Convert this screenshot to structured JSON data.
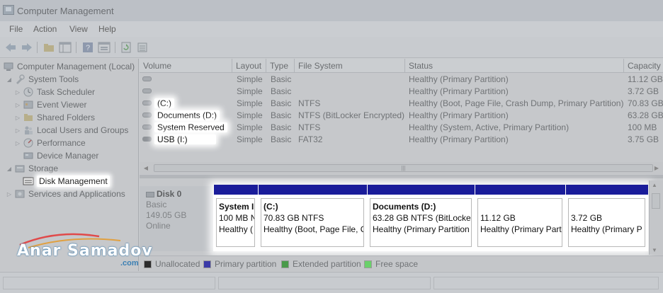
{
  "window": {
    "title": "Computer Management"
  },
  "menu": [
    {
      "label": "File"
    },
    {
      "label": "Action"
    },
    {
      "label": "View"
    },
    {
      "label": "Help"
    }
  ],
  "toolbar": {
    "back_icon": "back-arrow-icon",
    "forward_icon": "forward-arrow-icon",
    "up_icon": "up-folder-icon",
    "show_hide_icon": "show-hide-tree-icon",
    "help_icon": "help-icon",
    "properties_icon": "properties-icon",
    "refresh_icon": "refresh-icon",
    "export_icon": "export-list-icon"
  },
  "tree": {
    "root": "Computer Management (Local)",
    "items": [
      {
        "label": "System Tools",
        "icon": "tools-icon"
      },
      {
        "label": "Task Scheduler",
        "icon": "clock-icon"
      },
      {
        "label": "Event Viewer",
        "icon": "event-viewer-icon"
      },
      {
        "label": "Shared Folders",
        "icon": "shared-folder-icon"
      },
      {
        "label": "Local Users and Groups",
        "icon": "users-icon"
      },
      {
        "label": "Performance",
        "icon": "performance-icon"
      },
      {
        "label": "Device Manager",
        "icon": "device-manager-icon"
      },
      {
        "label": "Storage",
        "icon": "storage-icon"
      },
      {
        "label": "Disk Management",
        "icon": "disk-management-icon"
      },
      {
        "label": "Services and Applications",
        "icon": "services-icon"
      }
    ]
  },
  "volumes": {
    "columns": [
      "Volume",
      "Layout",
      "Type",
      "File System",
      "Status",
      "Capacity"
    ],
    "rows": [
      {
        "volume": "",
        "layout": "Simple",
        "type": "Basic",
        "fs": "",
        "status": "Healthy (Primary Partition)",
        "capacity": "11.12 GB"
      },
      {
        "volume": "",
        "layout": "Simple",
        "type": "Basic",
        "fs": "",
        "status": "Healthy (Primary Partition)",
        "capacity": "3.72 GB"
      },
      {
        "volume": "(C:)",
        "layout": "Simple",
        "type": "Basic",
        "fs": "NTFS",
        "status": "Healthy (Boot, Page File, Crash Dump, Primary Partition)",
        "capacity": "70.83 GB"
      },
      {
        "volume": "Documents (D:)",
        "layout": "Simple",
        "type": "Basic",
        "fs": "NTFS (BitLocker Encrypted)",
        "status": "Healthy (Primary Partition)",
        "capacity": "63.28 GB"
      },
      {
        "volume": "System Reserved",
        "layout": "Simple",
        "type": "Basic",
        "fs": "NTFS",
        "status": "Healthy (System, Active, Primary Partition)",
        "capacity": "100 MB"
      },
      {
        "volume": "USB (I:)",
        "layout": "Simple",
        "type": "Basic",
        "fs": "FAT32",
        "status": "Healthy (Primary Partition)",
        "capacity": "3.75 GB"
      }
    ]
  },
  "disk": {
    "name": "Disk 0",
    "type": "Basic",
    "size": "149.05 GB",
    "state": "Online",
    "partitions": [
      {
        "name": "System I",
        "size": "100 MB N",
        "status": "Healthy ("
      },
      {
        "name": "(C:)",
        "size": "70.83 GB NTFS",
        "status": "Healthy (Boot, Page File, C"
      },
      {
        "name": "Documents  (D:)",
        "size": "63.28 GB NTFS (BitLocker",
        "status": "Healthy (Primary Partition"
      },
      {
        "name": "",
        "size": "11.12 GB",
        "status": "Healthy (Primary Part"
      },
      {
        "name": "",
        "size": "3.72 GB",
        "status": "Healthy (Primary P"
      }
    ]
  },
  "legend": [
    {
      "label": "Unallocated",
      "color": "#2b2b2b"
    },
    {
      "label": "Primary partition",
      "color": "#3a3aa8"
    },
    {
      "label": "Extended partition",
      "color": "#4a9a4a"
    },
    {
      "label": "Free space",
      "color": "#6ad06a"
    }
  ],
  "watermark": {
    "text": "Anar Samadov",
    "sub": ".com"
  },
  "colors": {
    "partition_bar": "#1a1c9a",
    "highlight": "#ffffff"
  }
}
